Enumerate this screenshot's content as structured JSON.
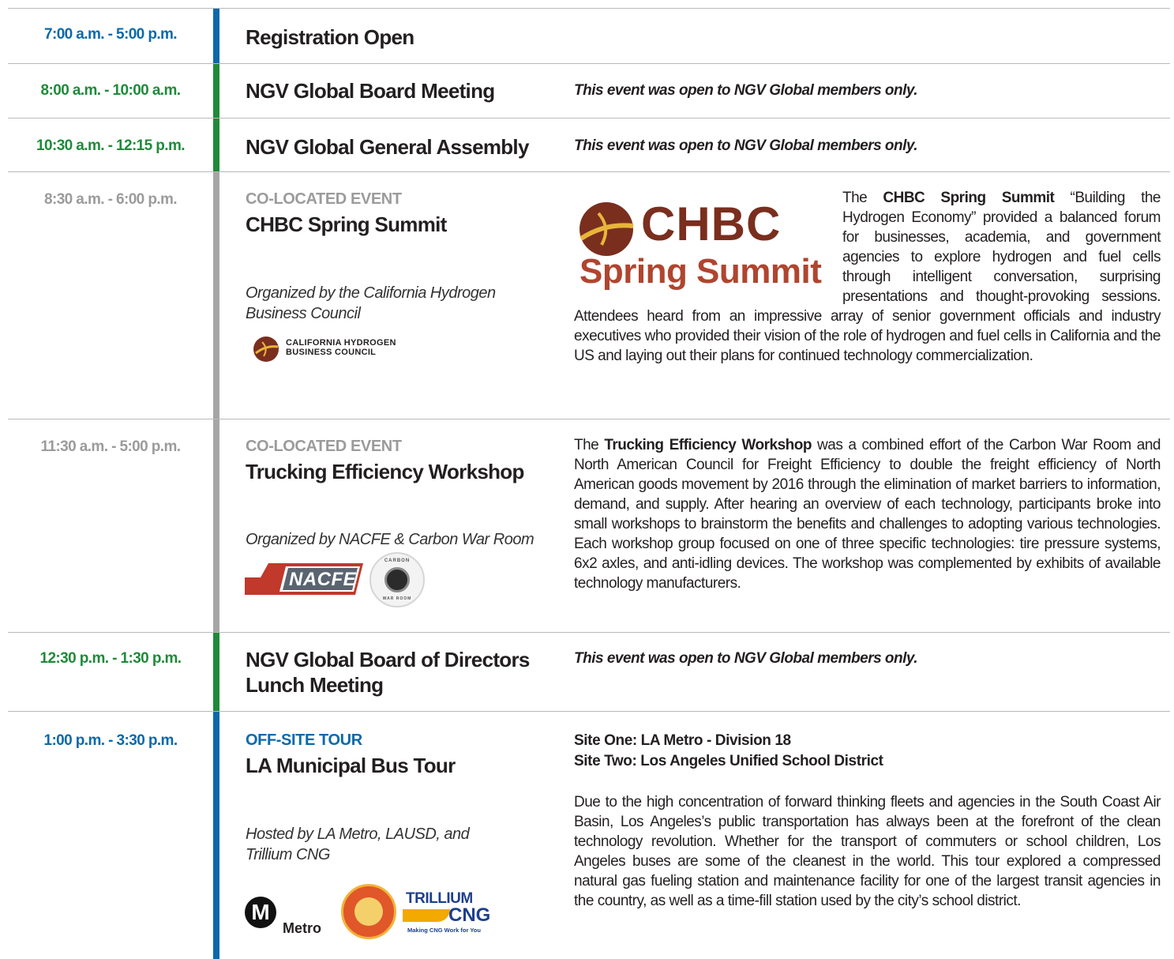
{
  "rows": [
    {
      "time": "7:00 a.m. - 5:00 p.m.",
      "title": "Registration Open"
    },
    {
      "time": "8:00 a.m. - 10:00 a.m.",
      "title": "NGV Global Board Meeting",
      "note": "This event was open to NGV Global members only."
    },
    {
      "time": "10:30 a.m. - 12:15 p.m.",
      "title": "NGV Global General Assembly",
      "note": "This event was open to NGV Global members only."
    },
    {
      "time": "8:30 a.m. - 6:00 p.m.",
      "kicker": "CO-LOCATED EVENT",
      "title": "CHBC Spring Summit",
      "organizer": "Organized by the California Hydrogen Business Council",
      "logo_small_line1": "California Hydrogen",
      "logo_small_line2": "Business Council",
      "logo_big_line1": "CHBC",
      "logo_big_line2": "Spring Summit",
      "desc_pre": "The ",
      "desc_bold": "CHBC Spring Summit",
      "desc_post": " “Building the Hydrogen Economy” provided a balanced forum for businesses, academia, and government agencies to explore hydrogen and fuel cells through intelligent conversation, surprising presentations and thought-provoking sessions. Attendees heard from an impressive array of senior government officials and industry executives who provided their vision of the role of hydrogen and fuel cells in California and the US and laying out their plans for continued technology commercialization."
    },
    {
      "time": "11:30 a.m. - 5:00 p.m.",
      "kicker": "CO-LOCATED EVENT",
      "title": "Trucking Efficiency Workshop",
      "organizer": "Organized by NACFE & Carbon War Room",
      "logo_nacfe": "NACFE",
      "logo_cwr_top": "CARBON",
      "logo_cwr_bottom": "WAR ROOM",
      "desc_pre": "The ",
      "desc_bold": "Trucking Efficiency Workshop",
      "desc_post": " was a combined effort of the Carbon War Room and North American Council for Freight Efficiency to double the freight efficiency of North American goods movement by 2016 through the elimination of market barriers to information, demand, and supply. After hearing an overview of each technology, participants broke into small workshops to brainstorm the benefits and challenges to adopting various technologies. Each workshop group focused on one of three specific technologies: tire pressure systems, 6x2 axles, and anti-idling devices. The workshop was complemented by exhibits of available technology manufacturers."
    },
    {
      "time": "12:30 p.m. - 1:30 p.m.",
      "title": "NGV Global Board of Directors Lunch Meeting",
      "note": "This event was open to NGV Global members only."
    },
    {
      "time": "1:00 p.m. - 3:30 p.m.",
      "kicker": "OFF-SITE TOUR",
      "title": "LA Municipal Bus Tour",
      "organizer": "Hosted by LA Metro, LAUSD, and Trillium CNG",
      "logo_metro_letter": "M",
      "logo_metro": "Metro",
      "logo_trillium": "TRILLIUM",
      "logo_cng": "CNG",
      "logo_trillium_tag": "Making CNG Work for You",
      "site_one": "Site One: LA Metro - Division 18",
      "site_two": "Site Two: Los Angeles Unified School District",
      "desc": "Due to the high concentration of forward thinking fleets and agencies in the South Coast Air Basin, Los Angeles’s public transportation has always been at the forefront of the clean technology revolution. Whether for the transport of commuters or school children, Los Angeles buses are some of the cleanest in the world. This tour explored a compressed natural gas fueling station and maintenance facility for one of the largest transit agencies in the country, as well as a time-fill station used by the city’s school district."
    }
  ],
  "colors": {
    "blue": "#0a69aa",
    "green": "#1f8a3a",
    "gray": "#9b9b9b",
    "chbc_brown": "#7a2e1e",
    "chbc_red": "#b0452f"
  }
}
